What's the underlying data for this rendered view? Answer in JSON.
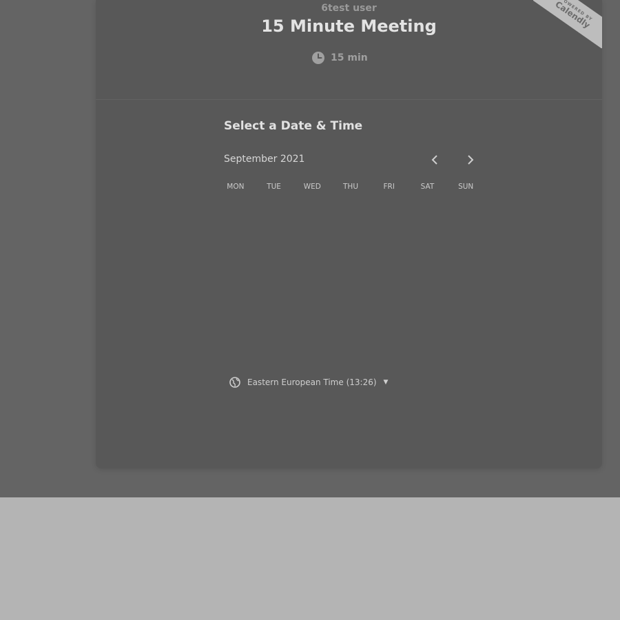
{
  "header": {
    "host_name": "6test user",
    "event_title": "15 Minute Meeting",
    "duration": "15 min",
    "duration_icon": "clock-icon",
    "ribbon_small": "POWERED BY",
    "ribbon_brand": "Calendly"
  },
  "scheduler": {
    "section_title": "Select a Date & Time",
    "month_label": "September 2021",
    "prev_icon": "chevron-left-icon",
    "next_icon": "chevron-right-icon",
    "weekdays": [
      "MON",
      "TUE",
      "WED",
      "THU",
      "FRI",
      "SAT",
      "SUN"
    ]
  },
  "timezone": {
    "icon": "globe-icon",
    "label": "Eastern European Time (13:26)",
    "dropdown_icon": "caret-down-icon"
  },
  "colors": {
    "overlay": "#646464",
    "card": "#585858",
    "page_background": "#b4b4b4",
    "ribbon": "#bdbdbd"
  }
}
